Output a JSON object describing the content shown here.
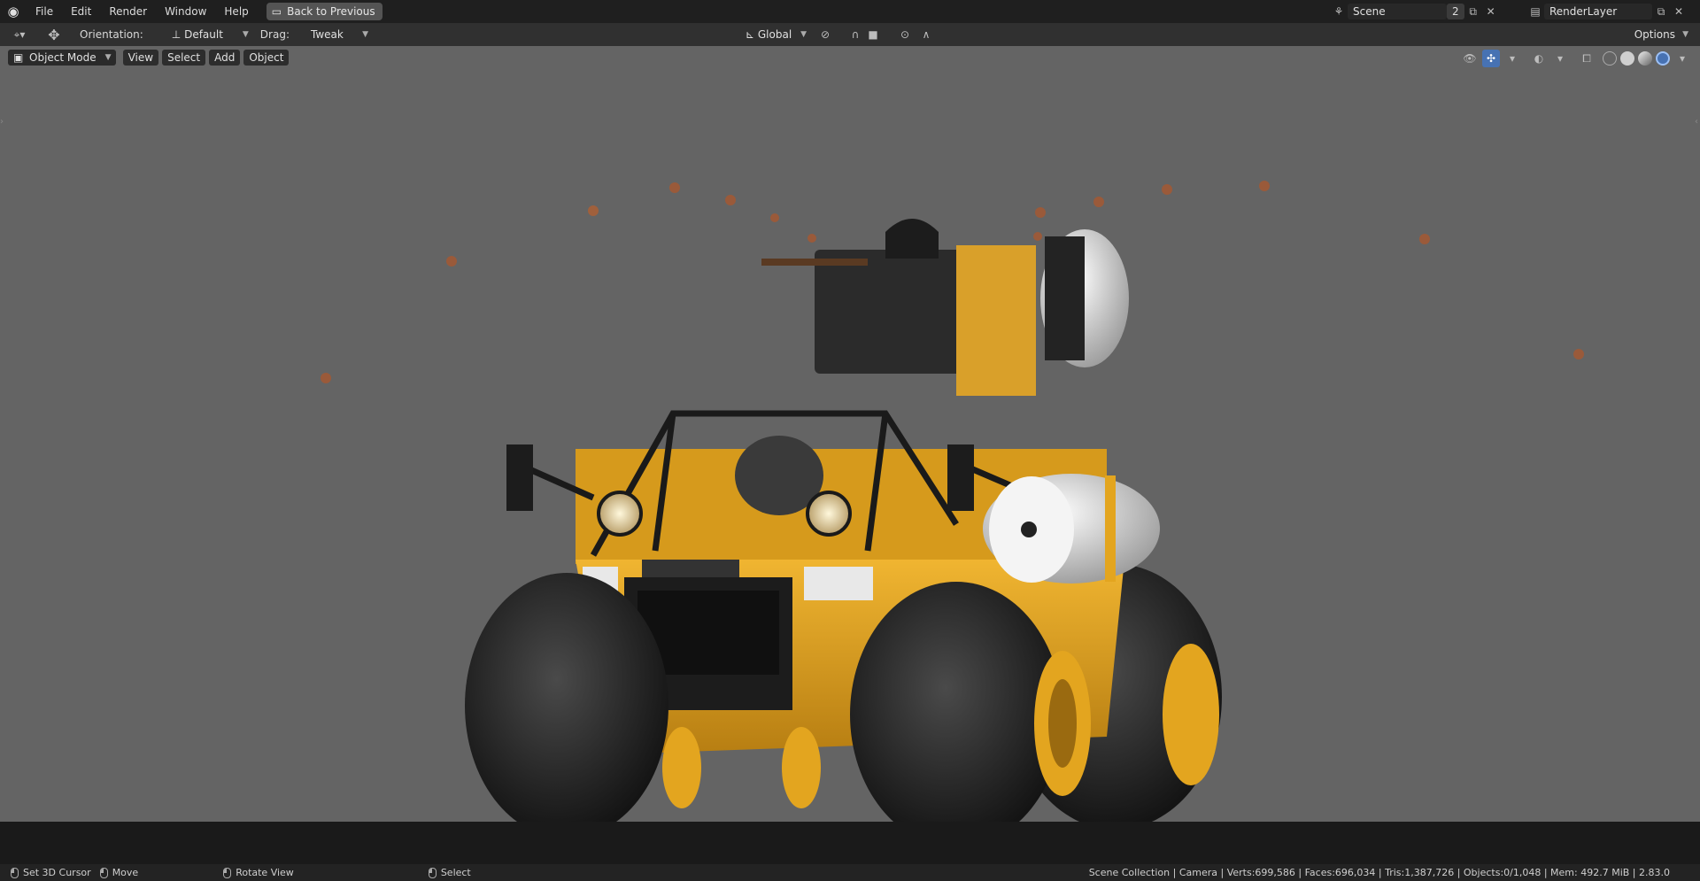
{
  "topbar": {
    "menus": [
      "File",
      "Edit",
      "Render",
      "Window",
      "Help"
    ],
    "back_label": "Back to Previous",
    "scene_name": "Scene",
    "scene_users": "2",
    "layer_name": "RenderLayer"
  },
  "header": {
    "orientation_label": "Orientation:",
    "orientation_value": "Default",
    "drag_label": "Drag:",
    "drag_value": "Tweak",
    "transform_space": "Global",
    "options_label": "Options"
  },
  "viewport_header": {
    "mode": "Object Mode",
    "menus": [
      "View",
      "Select",
      "Add",
      "Object"
    ]
  },
  "statusbar": {
    "hint_cursor": "Set 3D Cursor",
    "hint_move": "Move",
    "hint_rotate": "Rotate View",
    "hint_select": "Select",
    "stats": "Scene Collection | Camera | Verts:699,586 | Faces:696,034 | Tris:1,387,726 | Objects:0/1,048 | Mem: 492.7 MiB | 2.83.0"
  },
  "colors": {
    "viewport_bg": "#646464",
    "vehicle_yellow": "#e3a51f",
    "active_blue": "#4772b3"
  }
}
